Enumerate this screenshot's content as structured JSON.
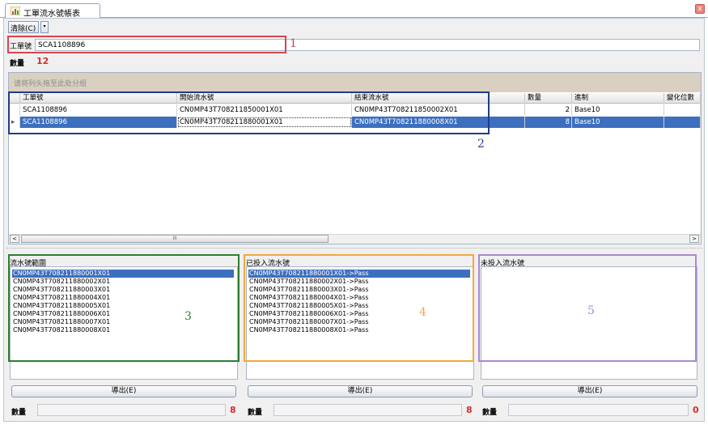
{
  "tab": {
    "title": "工單流水號帳表",
    "close": "x"
  },
  "toolbar": {
    "clear_label": "清除(C)",
    "dropdown": "▾"
  },
  "work_order": {
    "label": "工單號",
    "value": "SCA1108896"
  },
  "quantity": {
    "label": "數量",
    "value": "12"
  },
  "grid": {
    "group_panel": "请将列头拖至此处分组",
    "columns": [
      "工單號",
      "開始流水號",
      "結束流水號",
      "數量",
      "進制",
      "變化位數"
    ],
    "rows": [
      {
        "wo": "SCA1108896",
        "start": "CN0MP43T708211850001X01",
        "end": "CN0MP43T708211850002X01",
        "qty": "2",
        "base": "Base10",
        "digits": "",
        "indicator": ""
      },
      {
        "wo": "SCA1108896",
        "start": "CN0MP43T708211880001X01",
        "end": "CN0MP43T708211880008X01",
        "qty": "8",
        "base": "Base10",
        "digits": "",
        "indicator": "▸"
      }
    ],
    "scroll_grip": "III",
    "scroll_left": "<",
    "scroll_right": ">"
  },
  "panes": {
    "range": {
      "title": "流水號範圍",
      "items": [
        "CN0MP43T708211880001X01",
        "CN0MP43T708211880002X01",
        "CN0MP43T708211880003X01",
        "CN0MP43T708211880004X01",
        "CN0MP43T708211880005X01",
        "CN0MP43T708211880006X01",
        "CN0MP43T708211880007X01",
        "CN0MP43T708211880008X01"
      ],
      "export_label": "導出(E)",
      "count_label": "數量",
      "count_value": "8"
    },
    "input": {
      "title": "已投入流水號",
      "items": [
        "CN0MP43T708211880001X01->Pass",
        "CN0MP43T708211880002X01->Pass",
        "CN0MP43T708211880003X01->Pass",
        "CN0MP43T708211880004X01->Pass",
        "CN0MP43T708211880005X01->Pass",
        "CN0MP43T708211880006X01->Pass",
        "CN0MP43T708211880007X01->Pass",
        "CN0MP43T708211880008X01->Pass"
      ],
      "export_label": "導出(E)",
      "count_label": "數量",
      "count_value": "8"
    },
    "not_input": {
      "title": "未投入流水號",
      "items": [],
      "export_label": "導出(E)",
      "count_label": "數量",
      "count_value": "0"
    }
  },
  "annotations": {
    "n1": "1",
    "n2": "2",
    "n3": "3",
    "n4": "4",
    "n5": "5",
    "colors": {
      "n1": "#d64550",
      "n2": "#223a8e",
      "n3": "#2e7d32",
      "n4": "#f2a93b",
      "n5": "#a98ad0"
    }
  },
  "colors": {
    "selection": "#3d6fbf",
    "count_red": "#d32f2f",
    "group_panel": "#d9d0c2"
  }
}
